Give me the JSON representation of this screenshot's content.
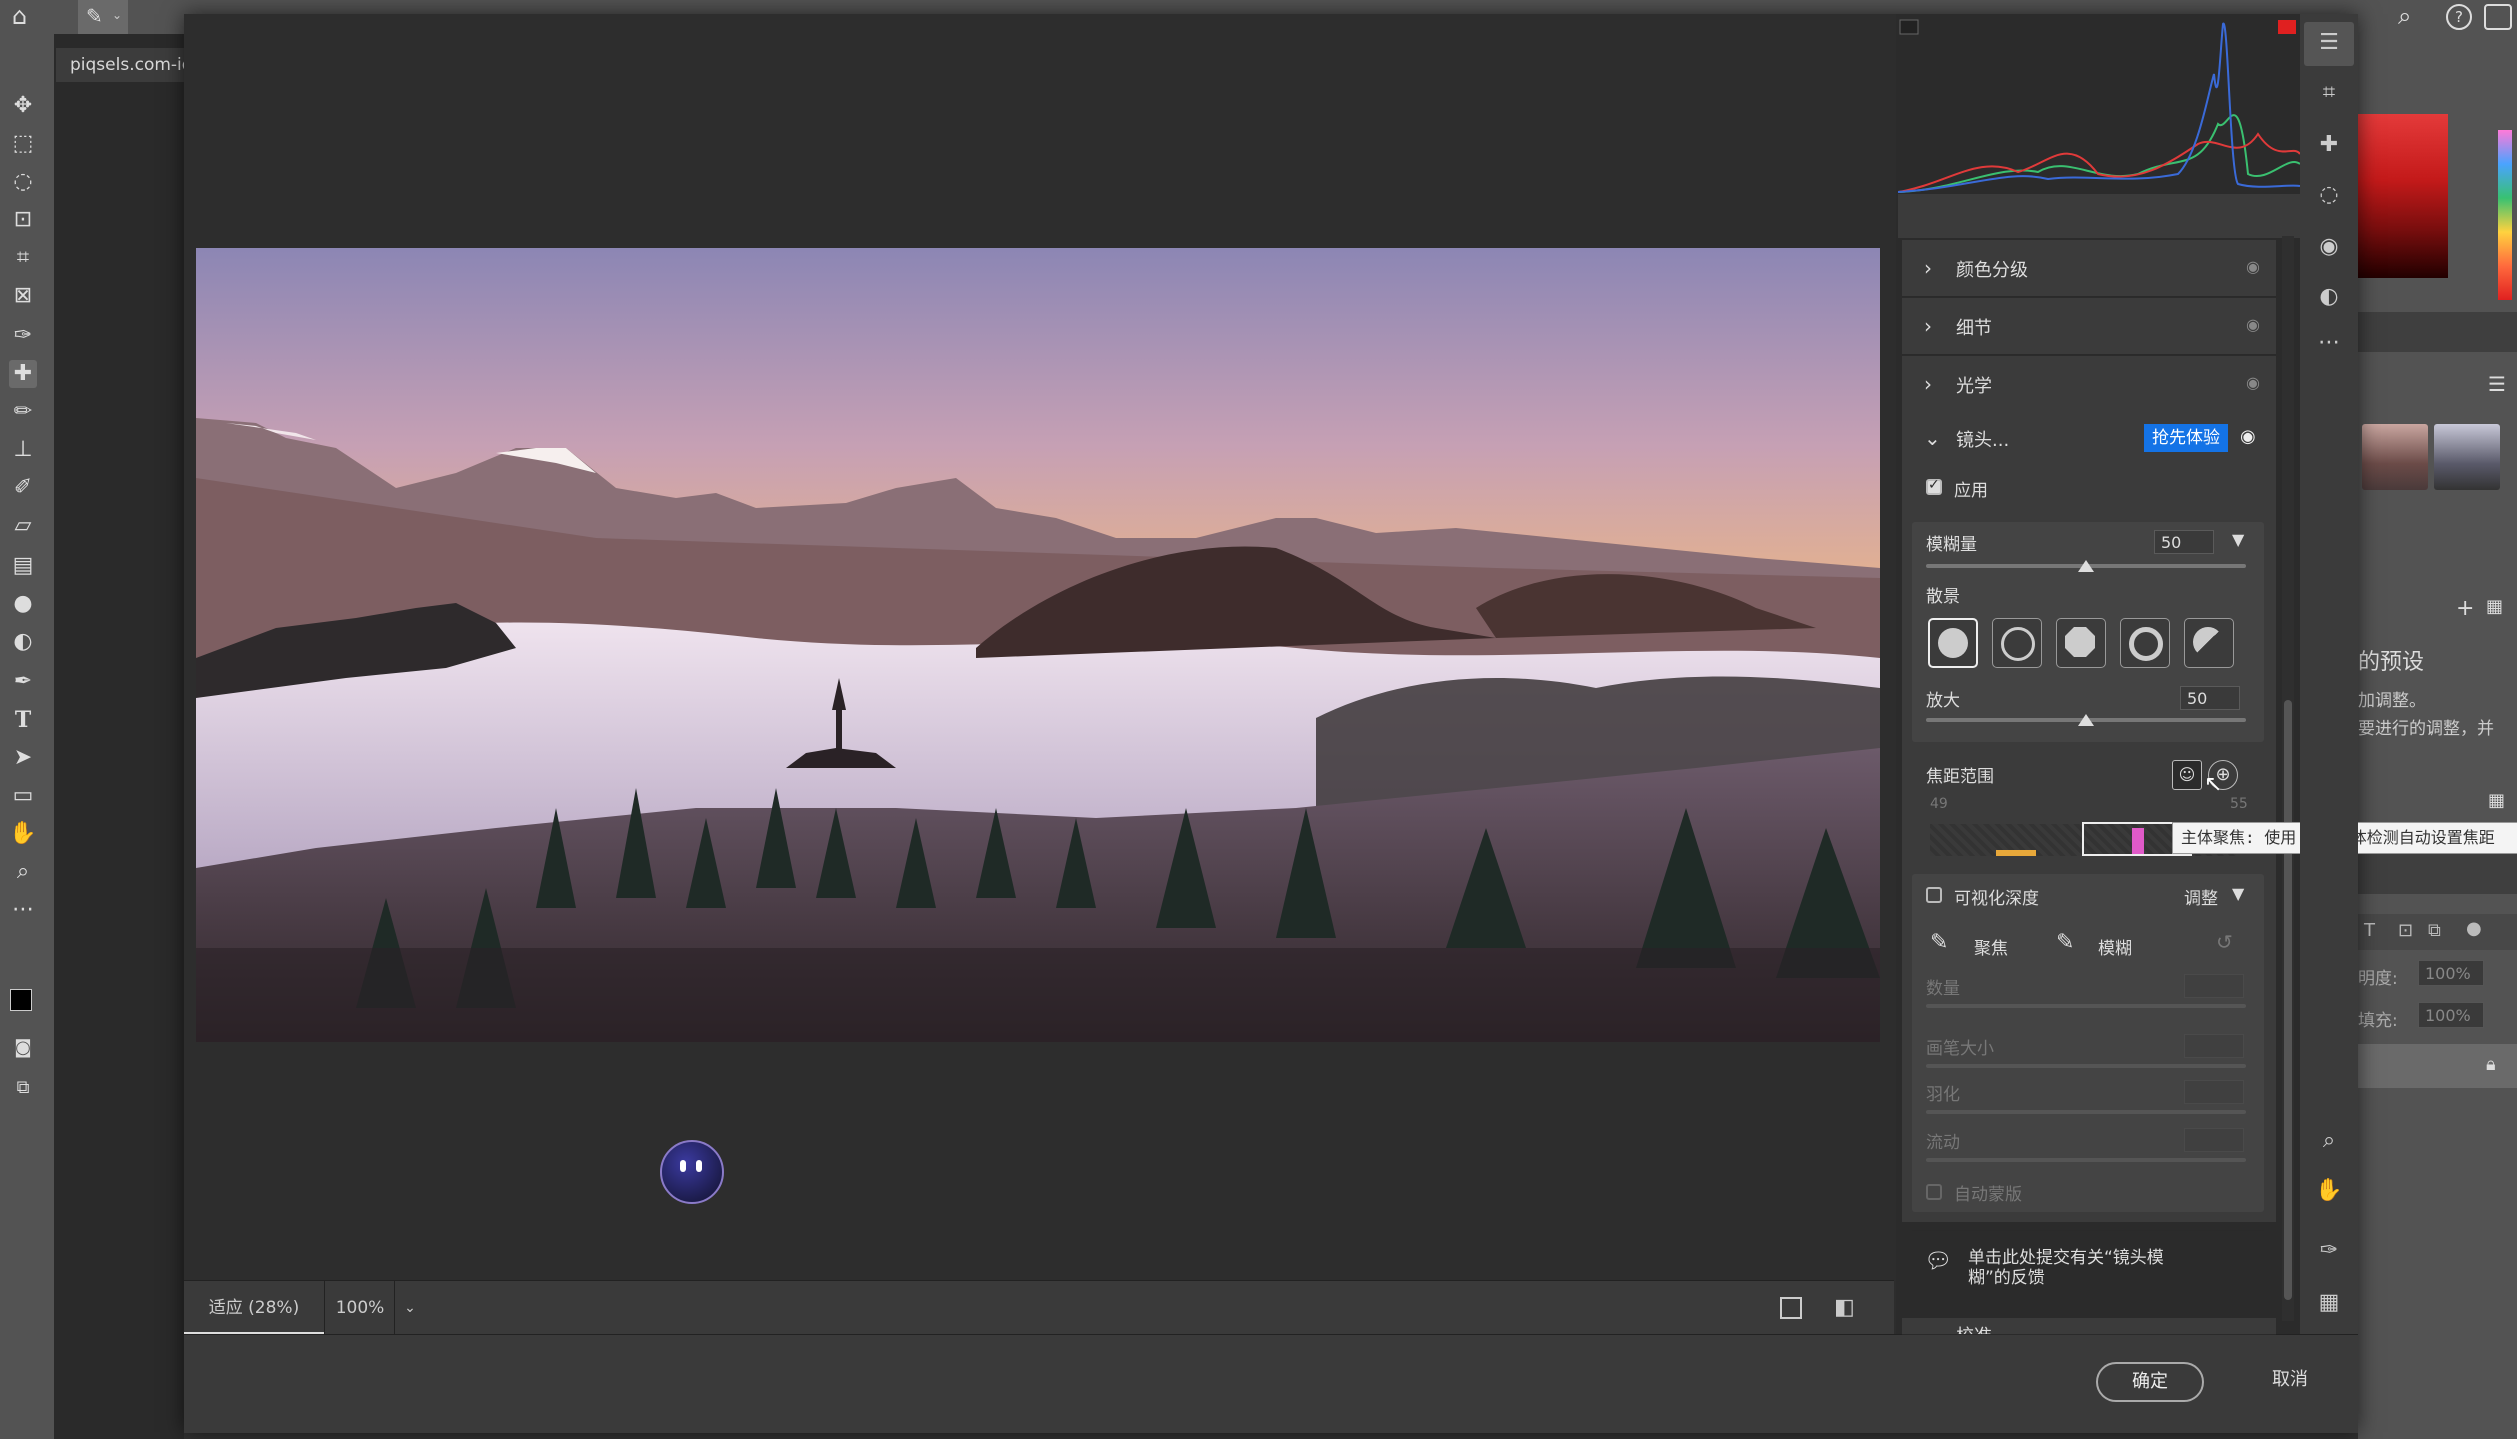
{
  "photoshop": {
    "doc_tab": "piqsels.com-id",
    "layers_panel": {
      "presets_title": "的预设",
      "presets_line1": "加调整。",
      "presets_line2": "要进行的调整，并",
      "opacity_label": "明度:",
      "opacity_value": "100%",
      "fill_label": "填充:",
      "fill_value": "100%"
    }
  },
  "acr": {
    "sections": [
      {
        "label": "颜色分级"
      },
      {
        "label": "细节"
      },
      {
        "label": "光学"
      }
    ],
    "lens": {
      "title": "镜头...",
      "badge": "抢先体验",
      "apply_label": "应用",
      "blur_amount_label": "模糊量",
      "blur_amount_value": "50",
      "bokeh_label": "散景",
      "boost_label": "放大",
      "boost_value": "50",
      "focal_range_label": "焦距范围",
      "focal_range_min": "49",
      "focal_range_max": "55",
      "tooltip": "主体聚焦: 使用 AI 主体检测自动设置焦距",
      "visualize_depth_label": "可视化深度",
      "adjust_label": "调整",
      "focus_brush_label": "聚焦",
      "blur_brush_label": "模糊",
      "amount_label": "数量",
      "brush_size_label": "画笔大小",
      "feather_label": "羽化",
      "flow_label": "流动",
      "auto_mask_label": "自动蒙版",
      "feedback_line1": "单击此处提交有关“镜头模",
      "feedback_line2": "糊”的反馈",
      "next_section": "校准"
    },
    "status": {
      "fit_label": "适应 (28%)",
      "zoom_label": "100%"
    },
    "buttons": {
      "ok": "确定",
      "cancel": "取消"
    }
  },
  "colors": {
    "accent": "#1473e6",
    "clip_warning": "#e02020"
  }
}
